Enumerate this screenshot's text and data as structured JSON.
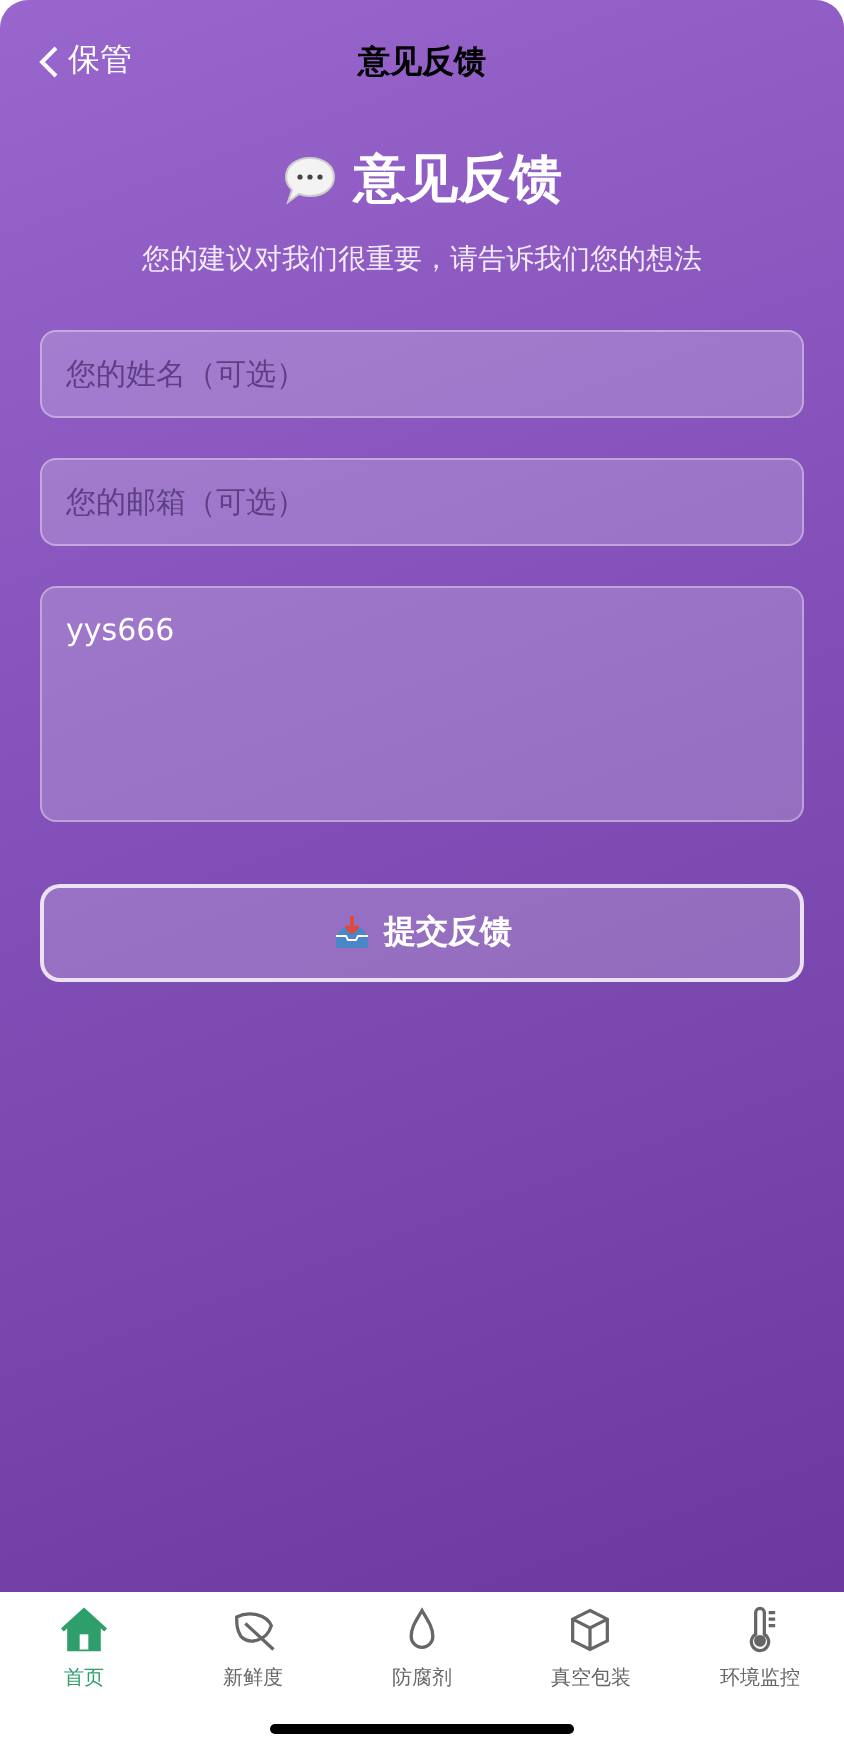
{
  "nav": {
    "back_label": "保管",
    "title": "意见反馈"
  },
  "header": {
    "title": "意见反馈",
    "subtitle": "您的建议对我们很重要，请告诉我们您的想法"
  },
  "form": {
    "fields": [
      {
        "kind": "input",
        "placeholder": "您的姓名（可选）"
      },
      {
        "kind": "input",
        "placeholder": "您的邮箱（可选）"
      },
      {
        "kind": "textarea",
        "value": "yys666"
      }
    ],
    "submit": "提交反馈"
  },
  "tabs": [
    {
      "kind": "home",
      "label": "首页",
      "selected": true
    },
    {
      "kind": "leaf",
      "label": "新鲜度",
      "selected": false
    },
    {
      "kind": "drop",
      "label": "防腐剂",
      "selected": false
    },
    {
      "kind": "box",
      "label": "真空包装",
      "selected": false
    },
    {
      "kind": "thermo",
      "label": "环境监控",
      "selected": false
    }
  ]
}
